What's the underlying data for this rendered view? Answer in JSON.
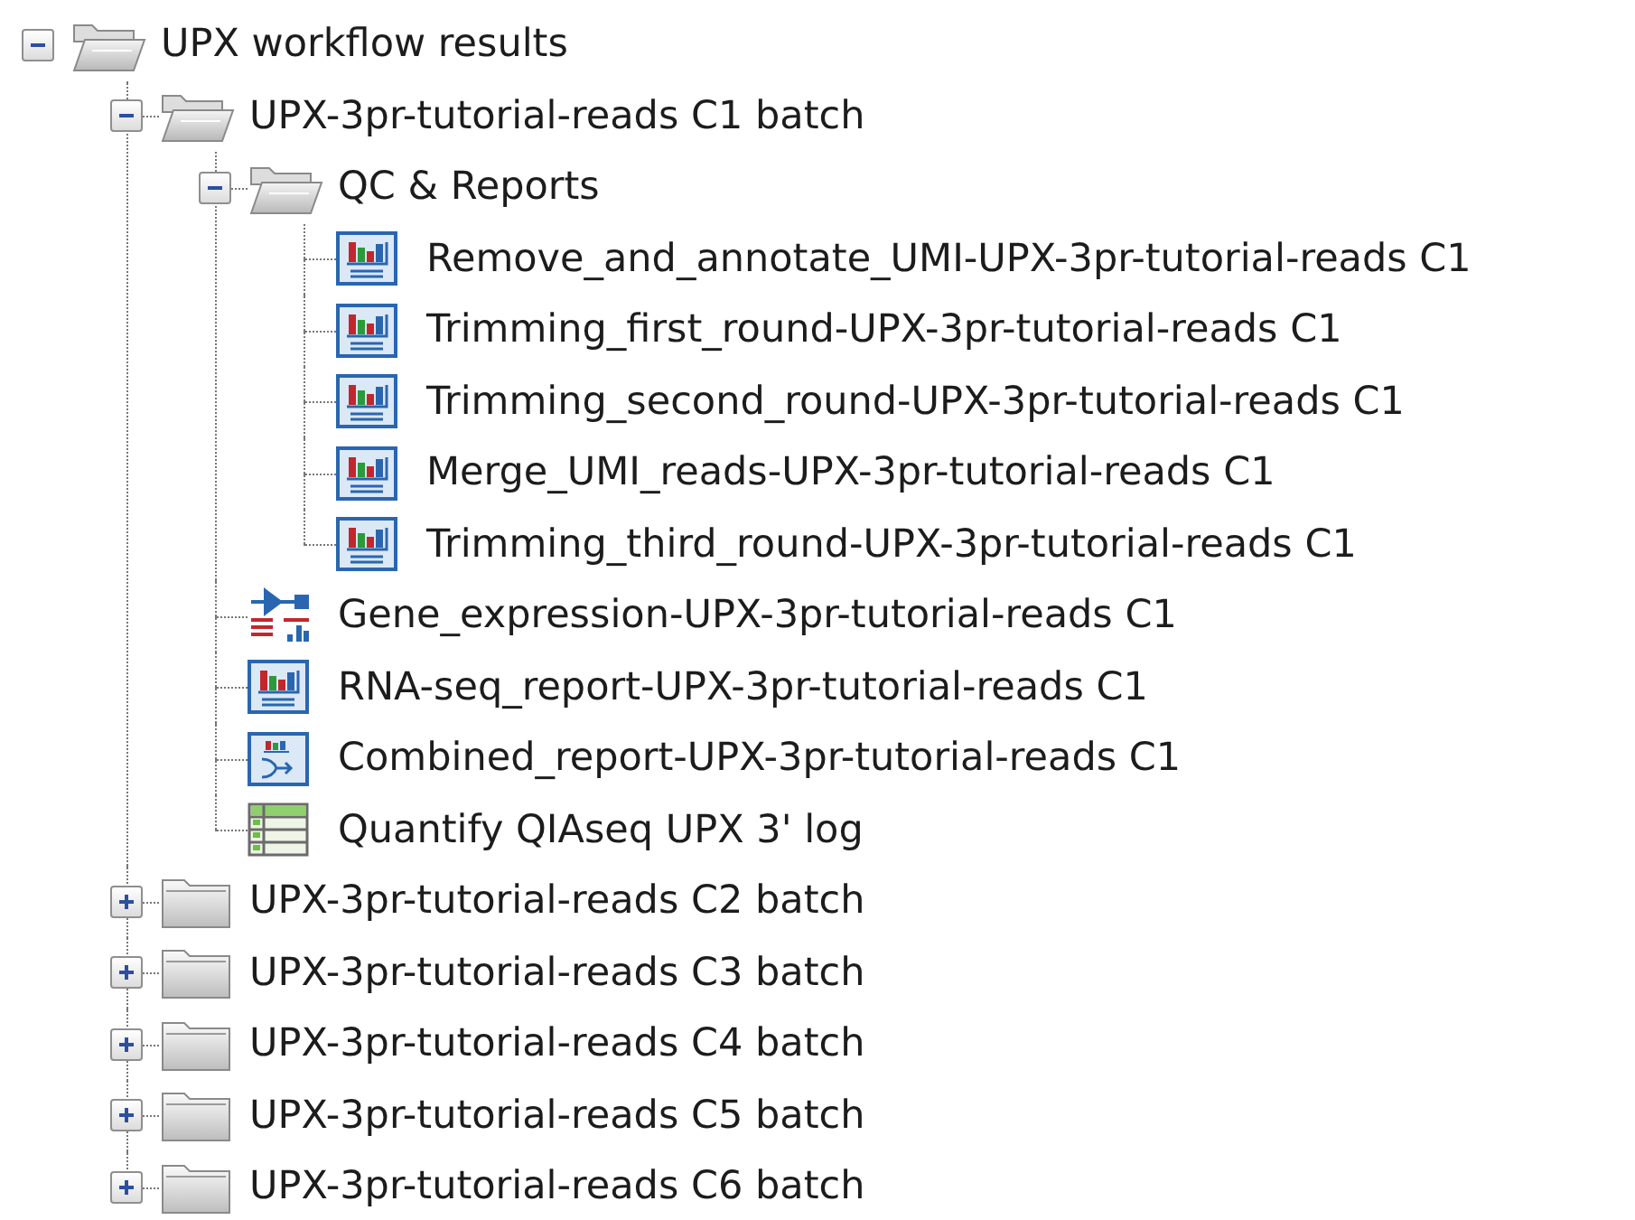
{
  "tree": [
    {
      "label": "UPX workflow results",
      "kind": "folder",
      "expanded": true,
      "children": [
        {
          "label": "UPX-3pr-tutorial-reads C1 batch",
          "kind": "folder",
          "expanded": true,
          "children": [
            {
              "label": "QC & Reports",
              "kind": "folder",
              "expanded": true,
              "children": [
                {
                  "label": "Remove_and_annotate_UMI-UPX-3pr-tutorial-reads C1",
                  "kind": "report"
                },
                {
                  "label": "Trimming_first_round-UPX-3pr-tutorial-reads C1",
                  "kind": "report"
                },
                {
                  "label": "Trimming_second_round-UPX-3pr-tutorial-reads C1",
                  "kind": "report"
                },
                {
                  "label": "Merge_UMI_reads-UPX-3pr-tutorial-reads C1",
                  "kind": "report"
                },
                {
                  "label": "Trimming_third_round-UPX-3pr-tutorial-reads C1",
                  "kind": "report"
                }
              ]
            },
            {
              "label": "Gene_expression-UPX-3pr-tutorial-reads C1",
              "kind": "expression"
            },
            {
              "label": "RNA-seq_report-UPX-3pr-tutorial-reads C1",
              "kind": "report"
            },
            {
              "label": "Combined_report-UPX-3pr-tutorial-reads C1",
              "kind": "combined"
            },
            {
              "label": "Quantify QIAseq UPX 3' log",
              "kind": "table"
            }
          ]
        },
        {
          "label": "UPX-3pr-tutorial-reads C2 batch",
          "kind": "folder",
          "expanded": false
        },
        {
          "label": "UPX-3pr-tutorial-reads C3 batch",
          "kind": "folder",
          "expanded": false
        },
        {
          "label": "UPX-3pr-tutorial-reads C4 batch",
          "kind": "folder",
          "expanded": false
        },
        {
          "label": "UPX-3pr-tutorial-reads C5 batch",
          "kind": "folder",
          "expanded": false
        },
        {
          "label": "UPX-3pr-tutorial-reads C6 batch",
          "kind": "folder",
          "expanded": false
        }
      ]
    }
  ]
}
